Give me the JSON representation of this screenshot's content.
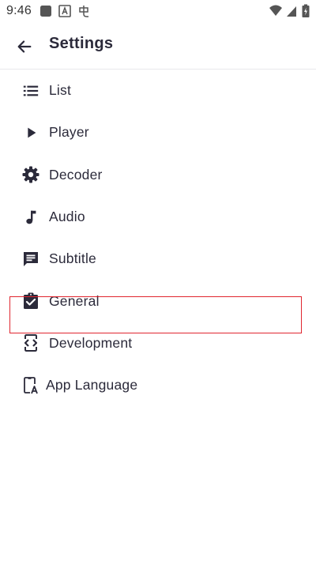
{
  "status_bar": {
    "time": "9:46",
    "left_icons": [
      "square-notification-icon",
      "font-notification-icon",
      "chinese-character-icon"
    ],
    "right_icons": [
      "wifi-icon",
      "cell-signal-icon",
      "battery-charging-icon"
    ]
  },
  "app_bar": {
    "title": "Settings",
    "back_icon": "arrow-back-icon"
  },
  "menu": {
    "items": [
      {
        "label": "List",
        "icon": "list-icon"
      },
      {
        "label": "Player",
        "icon": "play-icon"
      },
      {
        "label": "Decoder",
        "icon": "gear-icon"
      },
      {
        "label": "Audio",
        "icon": "music-note-icon"
      },
      {
        "label": "Subtitle",
        "icon": "subtitle-icon"
      },
      {
        "label": "General",
        "icon": "clipboard-check-icon"
      },
      {
        "label": "Development",
        "icon": "code-device-icon"
      },
      {
        "label": "App Language",
        "icon": "phone-language-icon"
      }
    ],
    "highlighted_item": "App Language"
  },
  "colors": {
    "text": "#2b2a3a",
    "highlight_border": "#e0262f",
    "divider": "#e8e8ec",
    "background": "#ffffff"
  }
}
